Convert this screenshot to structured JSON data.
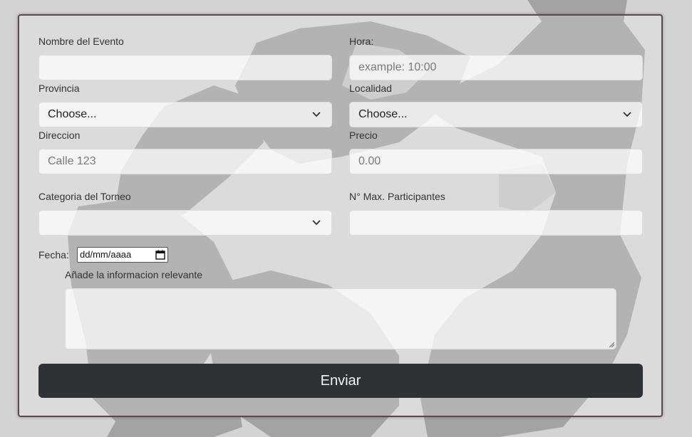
{
  "form": {
    "event_name": {
      "label": "Nombre del Evento",
      "value": "",
      "placeholder": ""
    },
    "time": {
      "label": "Hora:",
      "value": "",
      "placeholder": "example: 10:00"
    },
    "province": {
      "label": "Provincia",
      "selected": "Choose..."
    },
    "locality": {
      "label": "Localidad",
      "selected": "Choose..."
    },
    "address": {
      "label": "Direccion",
      "value": "",
      "placeholder": "Calle 123"
    },
    "price": {
      "label": "Precio",
      "value": "",
      "placeholder": "0.00"
    },
    "tournament_category": {
      "label": "Categoria del Torneo",
      "selected": ""
    },
    "max_participants": {
      "label": "N° Max. Participantes",
      "value": "",
      "placeholder": ""
    },
    "date": {
      "label": "Fecha:",
      "value": "dd/mm/aaaa"
    },
    "info": {
      "label": "Añade la informacion relevante",
      "value": ""
    },
    "submit_label": "Enviar"
  },
  "icons": {
    "select_arrow": "chevron-down-icon",
    "date_picker": "calendar-icon",
    "textarea_resize": "resize-handle-icon"
  },
  "colors": {
    "page_background": "#d3d3d3",
    "submit_button": "#2f3235",
    "submit_text": "#f2f2f2"
  }
}
